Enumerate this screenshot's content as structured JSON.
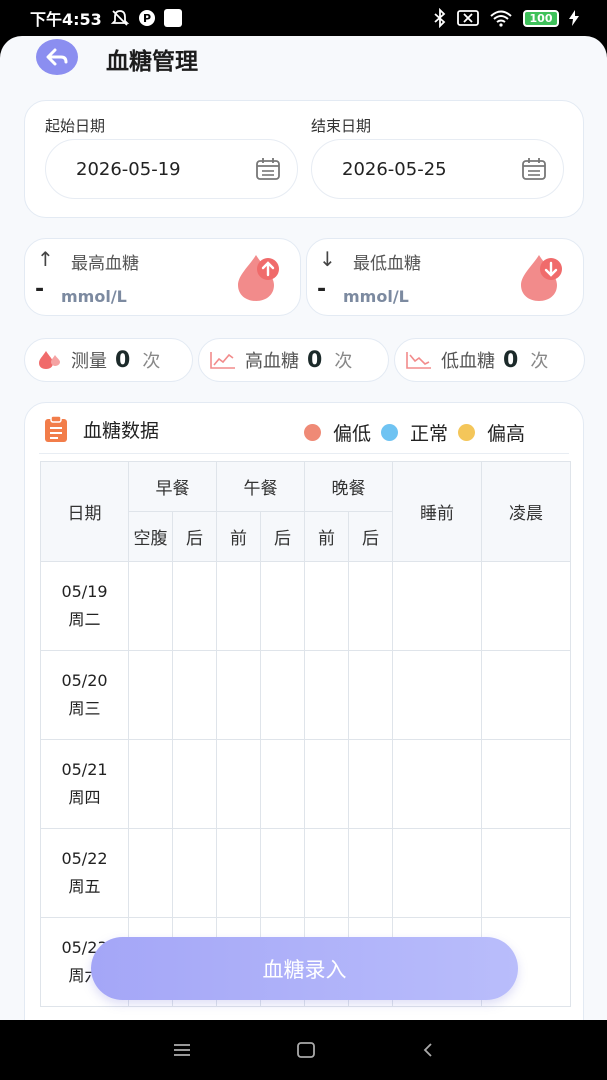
{
  "status_bar": {
    "time": "下午4:53",
    "battery": "100"
  },
  "header": {
    "title": "血糖管理"
  },
  "date_range": {
    "start_label": "起始日期",
    "start_value": "2026-05-19",
    "end_label": "结束日期",
    "end_value": "2026-05-25"
  },
  "stats": {
    "max": {
      "label": "最高血糖",
      "value": "-",
      "unit": "mmol/L"
    },
    "min": {
      "label": "最低血糖",
      "value": "-",
      "unit": "mmol/L"
    }
  },
  "counts": [
    {
      "label": "测量",
      "value": "0",
      "suffix": "次"
    },
    {
      "label": "高血糖",
      "value": "0",
      "suffix": "次"
    },
    {
      "label": "低血糖",
      "value": "0",
      "suffix": "次"
    }
  ],
  "data_card": {
    "title": "血糖数据",
    "legend": [
      {
        "label": "偏低",
        "color": "#ef8a76"
      },
      {
        "label": "正常",
        "color": "#6fc3f2"
      },
      {
        "label": "偏高",
        "color": "#f4c65a"
      }
    ]
  },
  "table": {
    "date_header": "日期",
    "groups": [
      "早餐",
      "午餐",
      "晚餐"
    ],
    "sub": [
      "空腹",
      "后",
      "前",
      "后",
      "前",
      "后"
    ],
    "bedtime": "睡前",
    "dawn": "凌晨",
    "rows": [
      {
        "date": "05/19",
        "weekday": "周二"
      },
      {
        "date": "05/20",
        "weekday": "周三"
      },
      {
        "date": "05/21",
        "weekday": "周四"
      },
      {
        "date": "05/22",
        "weekday": "周五"
      },
      {
        "date": "05/23",
        "weekday": "周六"
      }
    ]
  },
  "entry_button": "血糖录入"
}
